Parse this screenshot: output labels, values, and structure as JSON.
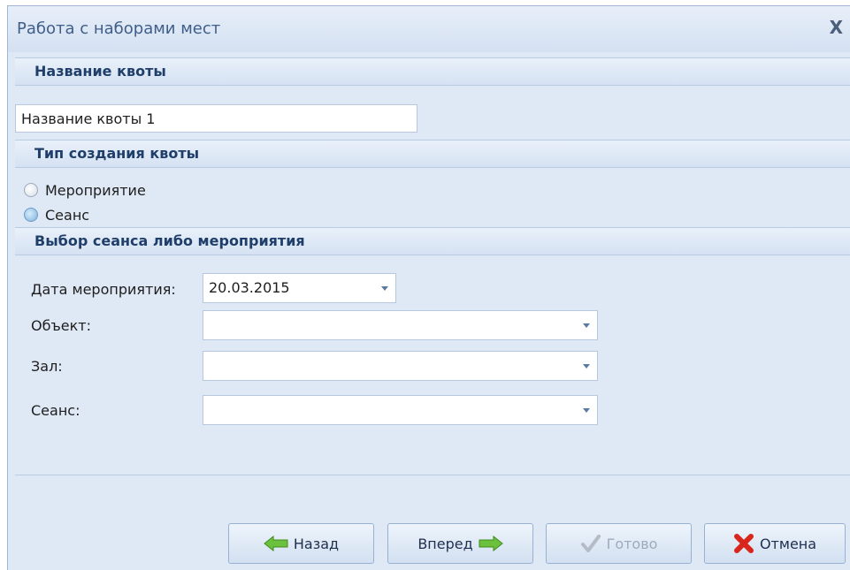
{
  "window": {
    "title": "Работа с наборами мест",
    "close_label": "X"
  },
  "sections": {
    "quota_name": {
      "header": "Название квоты",
      "input_value": "Название квоты 1"
    },
    "creation_type": {
      "header": "Тип создания квоты",
      "options": [
        {
          "label": "Мероприятие",
          "selected": false
        },
        {
          "label": "Сеанс",
          "selected": true
        }
      ]
    },
    "selection": {
      "header": "Выбор сеанса либо мероприятия",
      "fields": {
        "date": {
          "label": "Дата мероприятия:",
          "value": "20.03.2015"
        },
        "object": {
          "label": "Объект:",
          "value": ""
        },
        "hall": {
          "label": "Зал:",
          "value": ""
        },
        "session": {
          "label": "Сеанс:",
          "value": ""
        }
      }
    }
  },
  "buttons": {
    "back": {
      "label": "Назад",
      "icon": "arrow-left-icon",
      "enabled": true
    },
    "next": {
      "label": "Вперед",
      "icon": "arrow-right-icon",
      "enabled": true
    },
    "done": {
      "label": "Готово",
      "icon": "checkmark-icon",
      "enabled": false
    },
    "cancel": {
      "label": "Отмена",
      "icon": "red-x-icon",
      "enabled": true
    }
  },
  "colors": {
    "accent_green": "#5cb531",
    "cancel_red": "#d9261c",
    "header_text": "#1f3f6a"
  }
}
